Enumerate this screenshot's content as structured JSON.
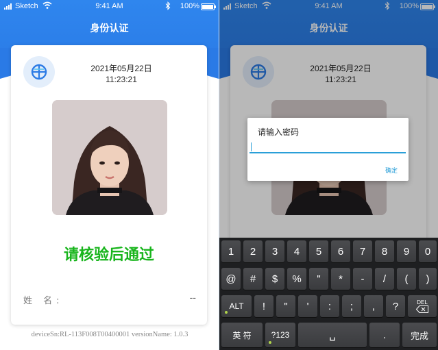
{
  "status_bar": {
    "carrier": "Sketch",
    "time": "9:41 AM",
    "battery": "100%"
  },
  "nav": {
    "title": "身份认证"
  },
  "card": {
    "date": "2021年05月22日",
    "time": "11:23:21",
    "verify_text": "请核验后通过",
    "name_label": "姓 名:",
    "name_value": "--"
  },
  "footer": {
    "text": "deviceSn:RL-113F008T00400001   versionName: 1.0.3"
  },
  "dialog": {
    "title": "请输入密码",
    "confirm_label": "确定",
    "input_value": ""
  },
  "keyboard": {
    "row1": [
      "1",
      "2",
      "3",
      "4",
      "5",
      "6",
      "7",
      "8",
      "9",
      "0"
    ],
    "row2": [
      "@",
      "#",
      "$",
      "%",
      "\"",
      "*",
      "-",
      "/",
      "(",
      ")"
    ],
    "row3": [
      "ALT",
      "!",
      "\"",
      "'",
      ":",
      ";",
      ",",
      "?"
    ],
    "delete_label": "DEL",
    "row4": {
      "lang": "英 符",
      "symbols": "?123",
      "space": "␣",
      "dot": ".",
      "enter": "完成"
    }
  },
  "colors": {
    "header_blue": "#2f86ee",
    "verify_green": "#19b51d",
    "accent_blue": "#2a9fd8"
  },
  "icons": [
    "signal-icon",
    "wifi-icon",
    "bluetooth-icon",
    "battery-icon",
    "id-logo-icon",
    "delete-icon",
    "space-icon"
  ]
}
